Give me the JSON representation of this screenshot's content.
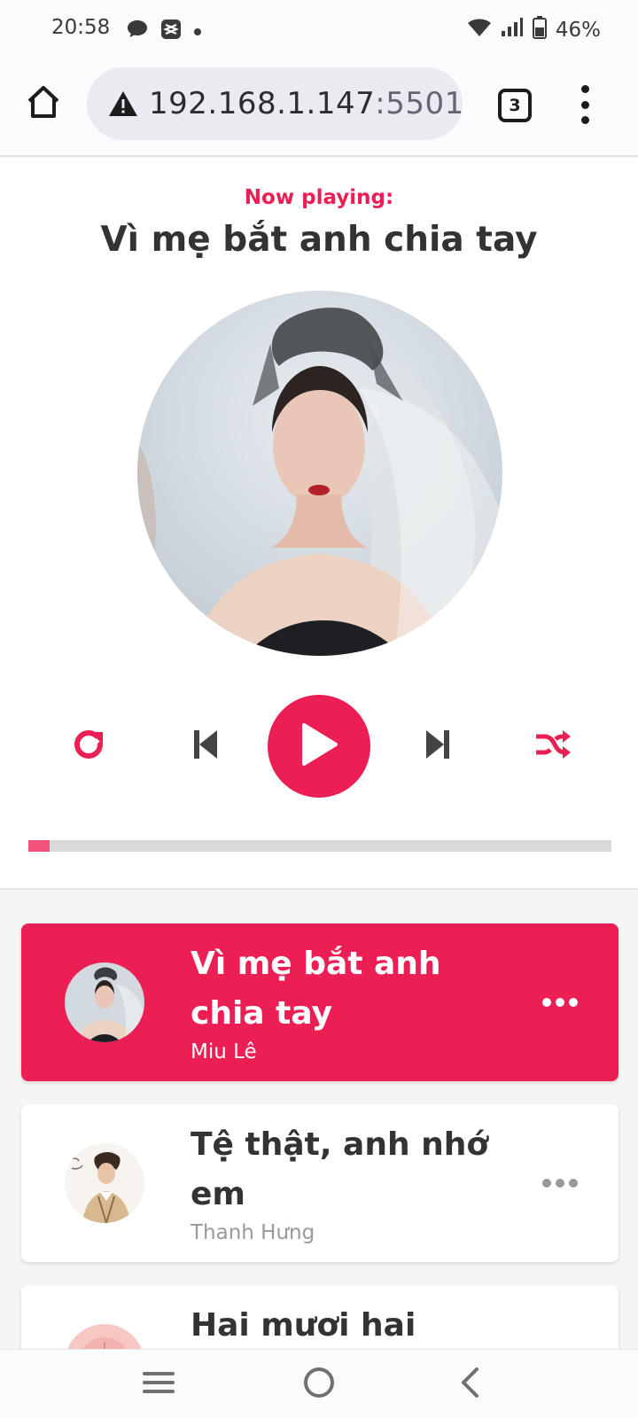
{
  "status_bar": {
    "time": "20:58",
    "battery": "46%",
    "icons": [
      "chat-bubble-icon",
      "capcut-icon",
      "dot-icon",
      "wifi-icon",
      "signal-icon",
      "battery-icon"
    ]
  },
  "browser": {
    "url_host": "192.168.1.147",
    "url_port": ":5501",
    "tab_count": "3",
    "icons": [
      "home-icon",
      "warning-icon",
      "tabs-icon",
      "more-vert-icon"
    ]
  },
  "player": {
    "label": "Now playing:",
    "title": "Vì mẹ bắt anh chia tay",
    "progress": 0.037,
    "accent": "#ec1f55",
    "controls": [
      "repeat-icon",
      "prev-icon",
      "play-icon",
      "next-icon",
      "random-icon"
    ]
  },
  "playlist": [
    {
      "title": "Vì mẹ bắt anh chia tay",
      "artist": "Miu Lê",
      "active": true
    },
    {
      "title": "Tệ thật, anh nhớ em",
      "artist": "Thanh Hưng",
      "active": false
    },
    {
      "title": "Hai mươi hai",
      "artist": "",
      "active": false
    }
  ],
  "nav_bar": {
    "icons": [
      "recents-icon",
      "home-circle-icon",
      "back-icon"
    ]
  }
}
